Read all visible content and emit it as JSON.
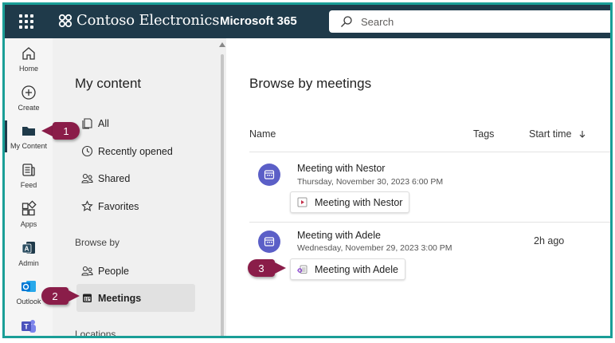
{
  "topbar": {
    "brand": "Contoso Electronics",
    "product": "Microsoft 365",
    "search_placeholder": "Search"
  },
  "rail": [
    {
      "label": "Home",
      "icon": "home-icon"
    },
    {
      "label": "Create",
      "icon": "plus-circle-icon"
    },
    {
      "label": "My Content",
      "icon": "folder-icon",
      "active": true
    },
    {
      "label": "Feed",
      "icon": "feed-icon"
    },
    {
      "label": "Apps",
      "icon": "apps-icon"
    },
    {
      "label": "Admin",
      "icon": "admin-icon"
    },
    {
      "label": "Outlook",
      "icon": "outlook-icon"
    },
    {
      "label": "",
      "icon": "teams-icon"
    }
  ],
  "pane": {
    "title": "My content",
    "nav": [
      {
        "label": "All",
        "icon": "all-icon"
      },
      {
        "label": "Recently opened",
        "icon": "clock-icon"
      },
      {
        "label": "Shared",
        "icon": "people-icon"
      },
      {
        "label": "Favorites",
        "icon": "star-icon"
      }
    ],
    "browse_by": "Browse by",
    "browse_items": [
      {
        "label": "People",
        "icon": "people-icon"
      },
      {
        "label": "Meetings",
        "icon": "calendar-icon",
        "selected": true
      }
    ],
    "locations": "Locations"
  },
  "main": {
    "title": "Browse by meetings",
    "columns": {
      "name": "Name",
      "tags": "Tags",
      "start_time": "Start time"
    },
    "meetings": [
      {
        "title": "Meeting with Nestor",
        "date": "Thursday, November 30, 2023 6:00 PM",
        "file": "Meeting with Nestor",
        "file_icon": "video-icon",
        "time": ""
      },
      {
        "title": "Meeting with Adele",
        "date": "Wednesday, November 29, 2023 3:00 PM",
        "file": "Meeting with Adele",
        "file_icon": "loop-icon",
        "time": "2h ago"
      }
    ]
  },
  "callouts": [
    "1",
    "2",
    "3"
  ],
  "colors": {
    "topbar": "#1f3a4a",
    "accent": "#5b5fc7",
    "callout": "#8a1d49",
    "frame": "#1a9e97"
  }
}
